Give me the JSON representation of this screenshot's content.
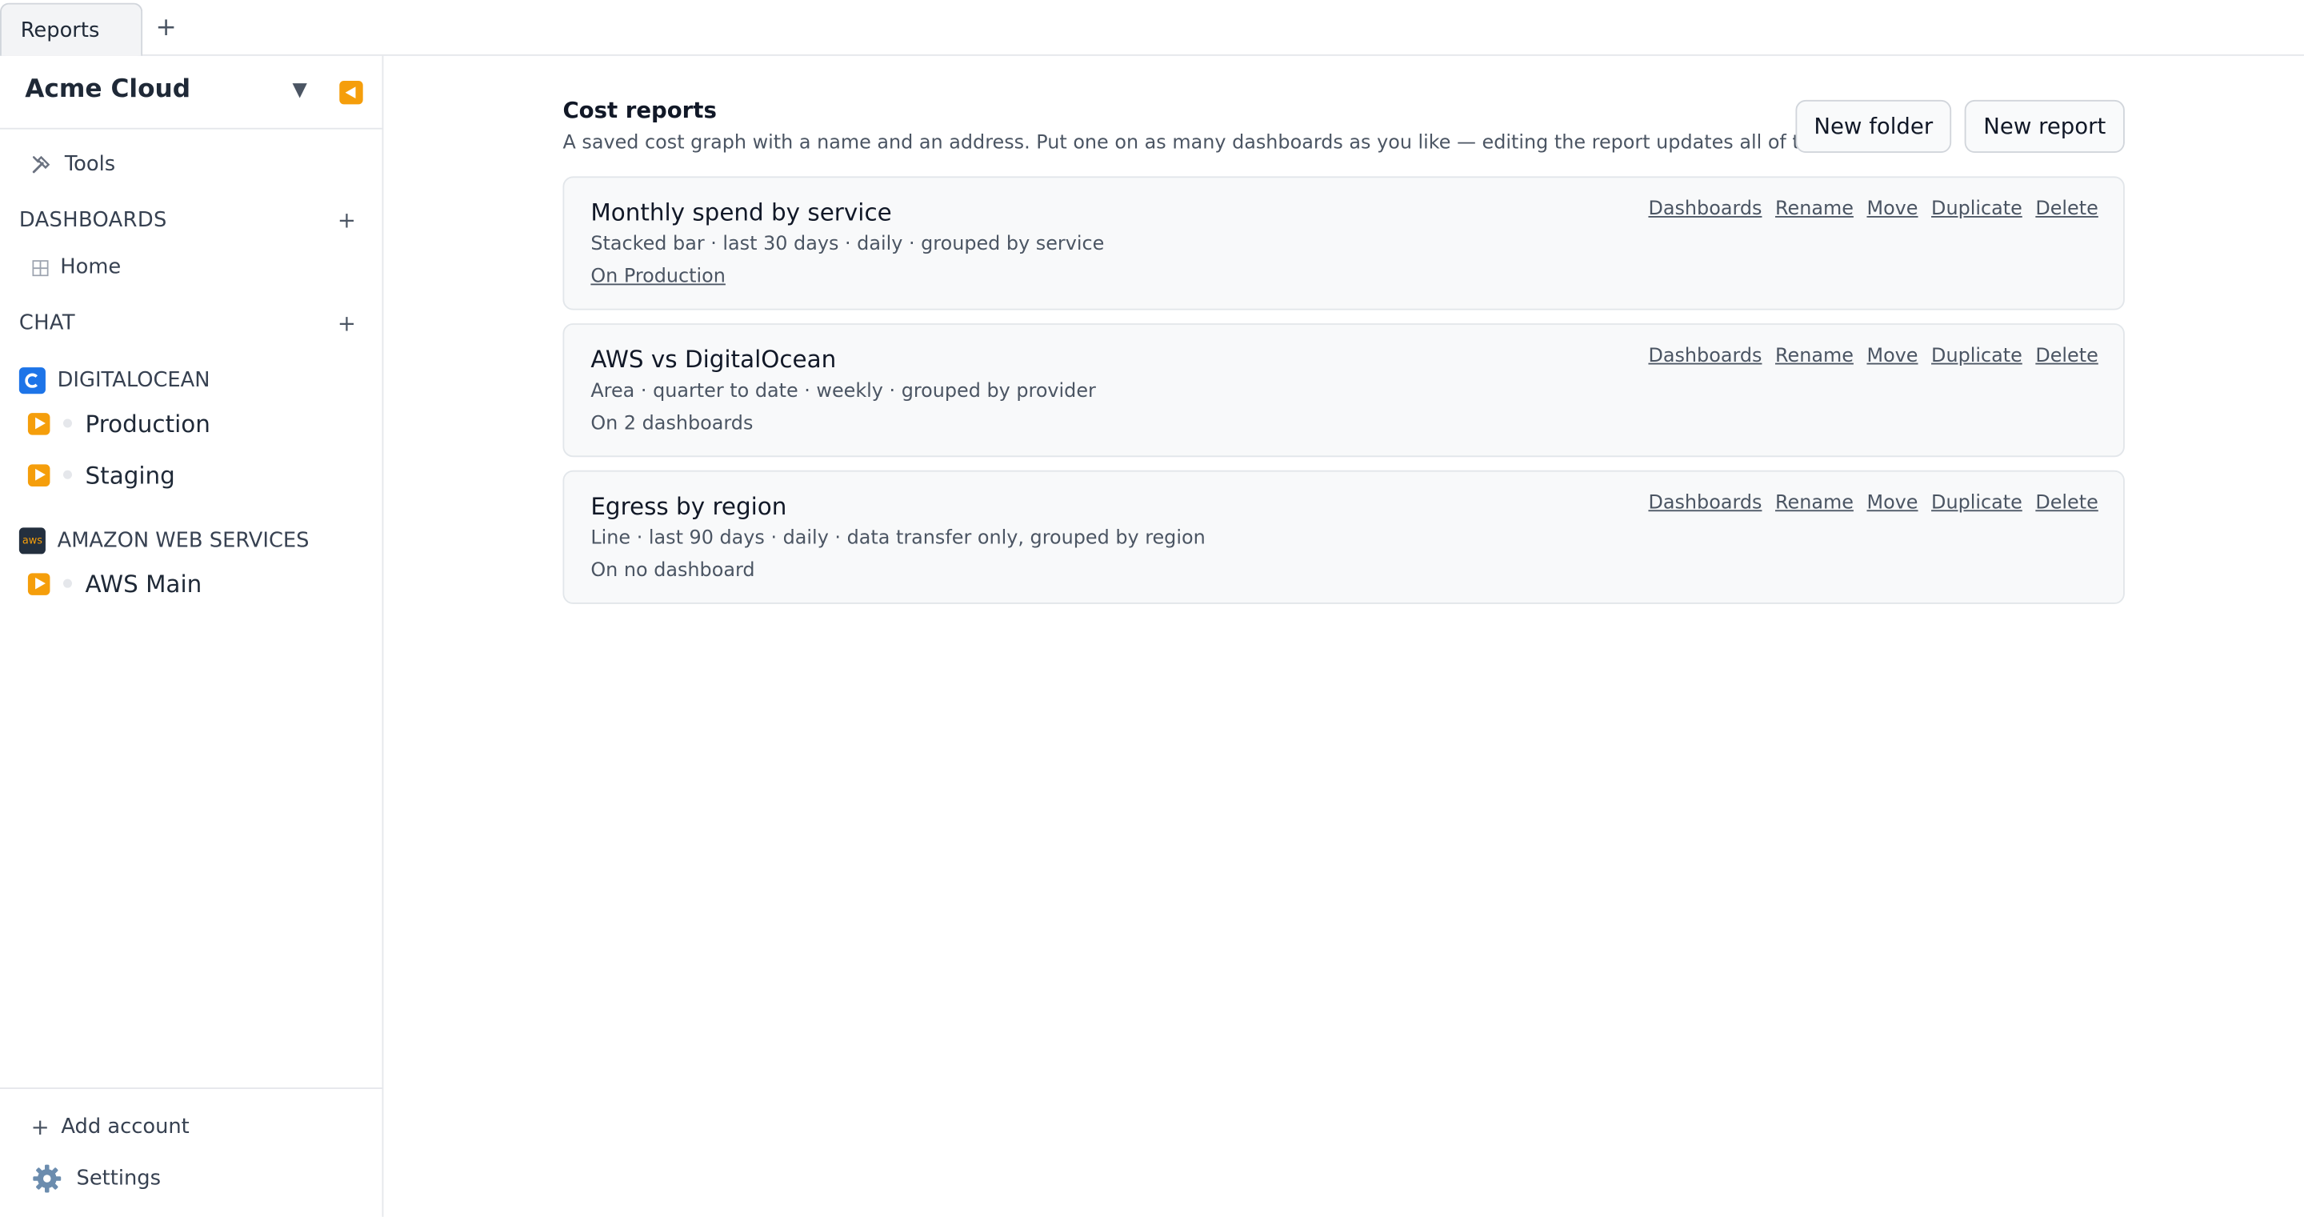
{
  "tabs": [
    {
      "label": "Reports"
    }
  ],
  "sidebar": {
    "org_name": "Acme Cloud",
    "tools_label": "Tools",
    "dashboards_header": "DASHBOARDS",
    "dashboards": [
      {
        "label": "Home"
      }
    ],
    "chat_header": "CHAT",
    "providers": [
      {
        "name": "DIGITALOCEAN",
        "icon": "digitalocean-icon",
        "accounts": [
          {
            "name": "Production"
          },
          {
            "name": "Staging"
          }
        ]
      },
      {
        "name": "AMAZON WEB SERVICES",
        "icon": "aws-icon",
        "icon_text": "aws",
        "accounts": [
          {
            "name": "AWS Main"
          }
        ]
      }
    ],
    "add_account_label": "Add account",
    "settings_label": "Settings"
  },
  "main": {
    "title": "Cost reports",
    "subtitle": "A saved cost graph with a name and an address. Put one on as many dashboards as you like — editing the report updates all of them.",
    "new_folder_label": "New folder",
    "new_report_label": "New report",
    "action_labels": [
      "Dashboards",
      "Rename",
      "Move",
      "Duplicate",
      "Delete"
    ],
    "reports": [
      {
        "name": "Monthly spend by service",
        "description": "Stacked bar · last 30 days · daily · grouped by service",
        "dashboards": "On Production",
        "dashboards_is_link": true
      },
      {
        "name": "AWS vs DigitalOcean",
        "description": "Area · quarter to date · weekly · grouped by provider",
        "dashboards": "On 2 dashboards",
        "dashboards_is_link": false
      },
      {
        "name": "Egress by region",
        "description": "Line · last 90 days · daily · data transfer only, grouped by region",
        "dashboards": "On no dashboard",
        "dashboards_is_link": false
      }
    ]
  },
  "colors": {
    "accent": "#f59e0b",
    "digitalocean": "#1d74e8",
    "aws": "#232f3e"
  }
}
